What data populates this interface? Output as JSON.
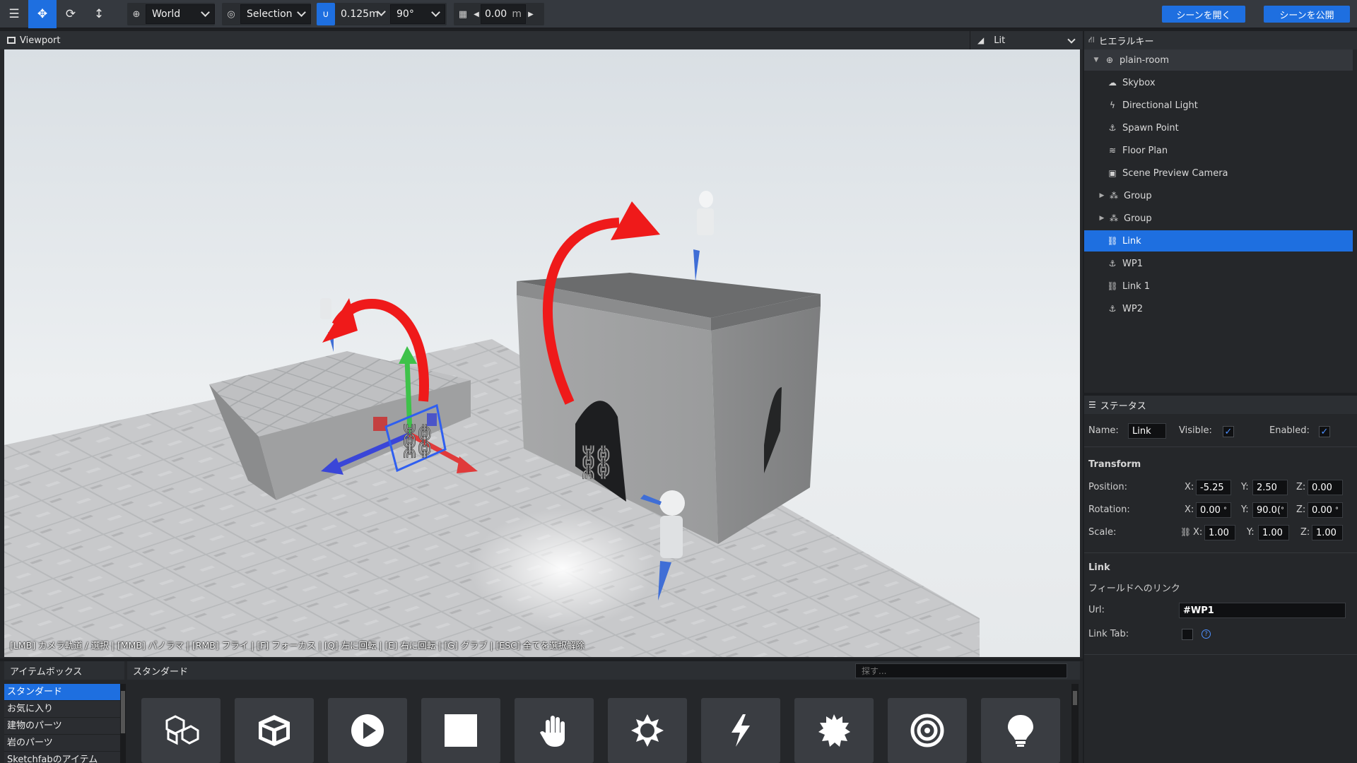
{
  "toolbar": {
    "tools": [
      {
        "icon": "menu-icon",
        "glyph": "☰"
      },
      {
        "icon": "move-icon",
        "glyph": "✥",
        "active": true
      },
      {
        "icon": "rotate-icon",
        "glyph": "⟳"
      },
      {
        "icon": "scale-icon",
        "glyph": "↕"
      }
    ],
    "space": {
      "icon": "globe-icon",
      "value": "World"
    },
    "pivot": {
      "icon": "pivot-icon",
      "value": "Selection"
    },
    "snap": {
      "icon": "magnet-icon",
      "distance": "0.125m",
      "angle": "90°"
    },
    "grid": {
      "icon": "grid-icon",
      "value": "0.00",
      "unit": "m"
    },
    "open_scene_label": "シーンを開く",
    "publish_scene_label": "シーンを公開"
  },
  "viewport": {
    "title": "Viewport",
    "shading": "Lit",
    "hint": "[LMB] カメラ軌道 / 選択 | [MMB] パノラマ | [RMB] フライ | [F] フォーカス | [Q] 左に回転 | [E] 右に回転 | [G] グラブ | [ESC] 全てを選択解除"
  },
  "itembox": {
    "title": "アイテムボックス",
    "current_category": "スタンダード",
    "search_placeholder": "探す...",
    "categories": [
      "スタンダード",
      "お気に入り",
      "建物のパーツ",
      "岩のパーツ",
      "Sketchfabのアイテム"
    ],
    "items": [
      "group-icon",
      "cube-icon",
      "play-icon",
      "square-icon",
      "hand-icon",
      "sun-icon",
      "lightning-icon",
      "burst-icon",
      "target-icon",
      "lightbulb-icon"
    ]
  },
  "hierarchy": {
    "title": "ヒエラルキー",
    "root": "plain-room",
    "items": [
      {
        "label": "Skybox",
        "icon": "cloud-icon"
      },
      {
        "label": "Directional Light",
        "icon": "lightning-icon"
      },
      {
        "label": "Spawn Point",
        "icon": "spawn-icon"
      },
      {
        "label": "Floor Plan",
        "icon": "floorplan-icon"
      },
      {
        "label": "Scene Preview Camera",
        "icon": "camera-icon"
      },
      {
        "label": "Group",
        "icon": "group-icon",
        "expandable": true
      },
      {
        "label": "Group",
        "icon": "group-icon",
        "expandable": true
      },
      {
        "label": "Link",
        "icon": "link-icon",
        "selected": true
      },
      {
        "label": "WP1",
        "icon": "spawn-icon"
      },
      {
        "label": "Link 1",
        "icon": "link-icon"
      },
      {
        "label": "WP2",
        "icon": "spawn-icon"
      }
    ]
  },
  "status": {
    "title": "ステータス",
    "name_label": "Name:",
    "name_value": "Link",
    "visible_label": "Visible:",
    "visible": true,
    "enabled_label": "Enabled:",
    "enabled": true,
    "transform_title": "Transform",
    "position_label": "Position:",
    "rotation_label": "Rotation:",
    "scale_label": "Scale:",
    "axis_x": "X:",
    "axis_y": "Y:",
    "axis_z": "Z:",
    "position": {
      "x": "-5.25",
      "y": "2.50",
      "z": "0.00"
    },
    "rotation": {
      "x": "0.00",
      "y": "90.0(",
      "z": "0.00"
    },
    "rotation_unit": "°",
    "scale": {
      "x": "1.00",
      "y": "1.00",
      "z": "1.00"
    },
    "link_title": "Link",
    "link_description": "フィールドへのリンク",
    "url_label": "Url:",
    "url_value": "#WP1",
    "link_tab_label": "Link Tab:",
    "link_tab": false,
    "help_glyph": "?"
  },
  "colors": {
    "accent": "#1e6fe0",
    "panel": "#25272a",
    "header": "#2c2f33",
    "toolbar": "#35393f",
    "gizmo_red": "#e03a3a",
    "gizmo_green": "#3ec24a",
    "gizmo_blue": "#3a46d8"
  }
}
